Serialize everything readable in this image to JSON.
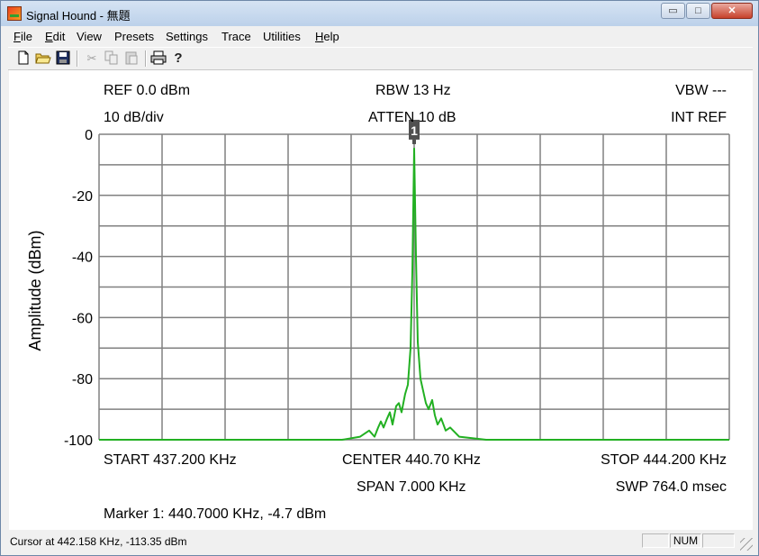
{
  "window": {
    "title": "Signal Hound - 無題"
  },
  "window_controls": {
    "minimize": "▭",
    "maximize": "□",
    "close": "✕"
  },
  "menu": {
    "items": [
      {
        "label": "File",
        "accel": "F"
      },
      {
        "label": "Edit",
        "accel": "E"
      },
      {
        "label": "View"
      },
      {
        "label": "Presets"
      },
      {
        "label": "Settings"
      },
      {
        "label": "Trace"
      },
      {
        "label": "Utilities"
      },
      {
        "label": "Help",
        "accel": "H"
      }
    ]
  },
  "toolbar": {
    "icons": [
      "new-file-icon",
      "open-folder-icon",
      "save-icon",
      "cut-icon",
      "copy-icon",
      "paste-icon",
      "print-icon",
      "help-question-icon"
    ]
  },
  "plot": {
    "ref": "REF 0.0 dBm",
    "scale": "10 dB/div",
    "rbw": "RBW 13 Hz",
    "atten": "ATTEN 10 dB",
    "vbw": "VBW ---",
    "int_ref": "INT REF",
    "start": "START 437.200 KHz",
    "center": "CENTER 440.70 KHz",
    "stop": "STOP 444.200 KHz",
    "span": "SPAN 7.000 KHz",
    "sweep": "SWP 764.0 msec",
    "marker_readout": "Marker 1: 440.7000 KHz, -4.7 dBm",
    "marker_label": "1",
    "trace_color": "#22b022",
    "grid_color": "#808080"
  },
  "chart_data": {
    "type": "line",
    "ylabel": "Amplitude (dBm)",
    "xlabel": "",
    "xlim": [
      437.2,
      444.2
    ],
    "ylim": [
      -100,
      0
    ],
    "y_ticks": [
      "0",
      "-20",
      "-40",
      "-60",
      "-80",
      "-100"
    ],
    "grid": true,
    "x_divisions": 10,
    "y_divisions": 10,
    "series": [
      {
        "x": [
          437.2,
          439.9,
          440.1,
          440.2,
          440.26,
          440.3,
          440.33,
          440.36,
          440.4,
          440.43,
          440.46,
          440.5,
          440.53,
          440.56,
          440.6,
          440.63,
          440.66,
          440.68,
          440.7,
          440.72,
          440.74,
          440.77,
          440.8,
          440.83,
          440.86,
          440.9,
          440.93,
          440.96,
          441.0,
          441.05,
          441.1,
          441.2,
          441.5,
          444.2
        ],
        "y": [
          -100,
          -100,
          -99,
          -97,
          -99,
          -96,
          -94,
          -96,
          -93,
          -91,
          -95,
          -89,
          -88,
          -91,
          -85,
          -82,
          -70,
          -45,
          -4.7,
          -40,
          -68,
          -80,
          -84,
          -88,
          -90,
          -87,
          -92,
          -95,
          -93,
          -97,
          -96,
          -99,
          -100,
          -100
        ]
      }
    ],
    "marker": {
      "x": 440.7,
      "y": -4.7,
      "label": "1"
    }
  },
  "status": {
    "cursor": "Cursor at 442.158 KHz, -113.35 dBm",
    "pane1": "",
    "num": "NUM",
    "pane3": ""
  }
}
